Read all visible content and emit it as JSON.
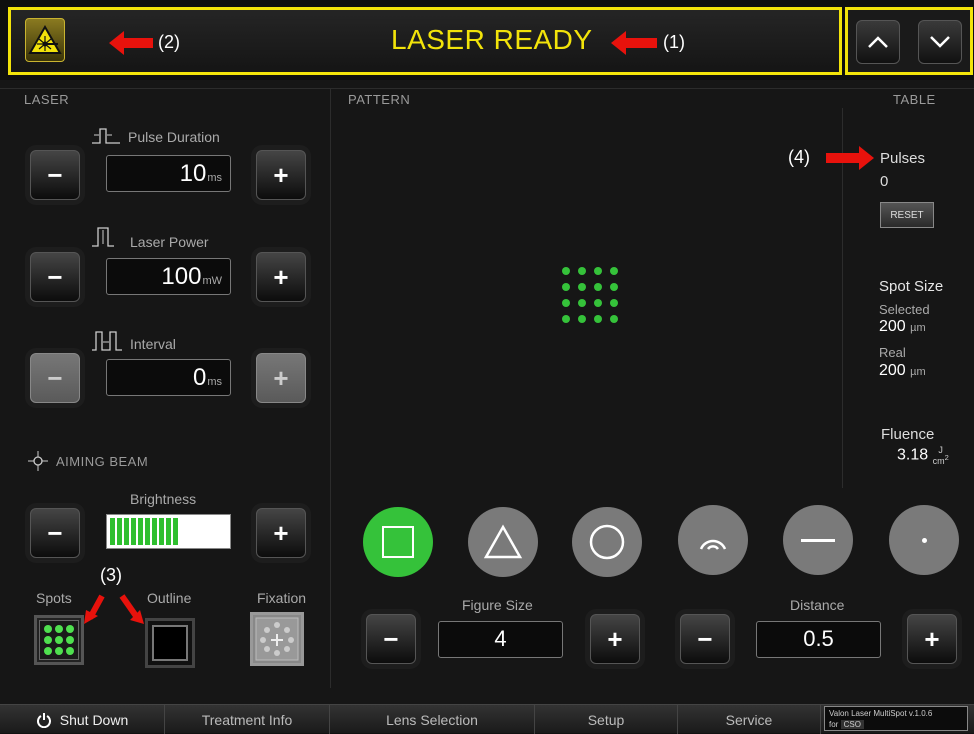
{
  "header": {
    "status": "LASER READY",
    "annotation_1": "(1)",
    "annotation_2": "(2)",
    "up_icon": "chevron-up-icon",
    "down_icon": "chevron-down-icon",
    "warning_icon": "laser-warning-icon",
    "status_color": "#f2e30a"
  },
  "laser": {
    "title": "LASER",
    "pulse_duration": {
      "label": "Pulse Duration",
      "value": "10",
      "unit": "ms"
    },
    "laser_power": {
      "label": "Laser Power",
      "value": "100",
      "unit": "mW"
    },
    "interval": {
      "label": "Interval",
      "value": "0",
      "unit": "ms"
    },
    "minus": "−",
    "plus": "+"
  },
  "aiming": {
    "title": "AIMING BEAM",
    "brightness_label": "Brightness",
    "brightness_level": 0.6,
    "spots_label": "Spots",
    "outline_label": "Outline",
    "fixation_label": "Fixation",
    "annotation_3": "(3)"
  },
  "pattern": {
    "title": "PATTERN",
    "grid_rows": 4,
    "grid_cols": 4,
    "figure_size_label": "Figure Size",
    "figure_size_value": "4",
    "distance_label": "Distance",
    "distance_value": "0.5",
    "shapes": [
      "square-icon",
      "triangle-icon",
      "circle-icon",
      "arc-icon",
      "line-icon",
      "dot-icon"
    ],
    "accent": "#35c23a"
  },
  "table": {
    "title": "TABLE",
    "pulses_label": "Pulses",
    "pulses_value": "0",
    "reset_label": "RESET",
    "spot_size_label": "Spot Size",
    "selected_label": "Selected",
    "selected_value": "200",
    "selected_unit": "µm",
    "real_label": "Real",
    "real_value": "200",
    "real_unit": "µm",
    "fluence_label": "Fluence",
    "fluence_value": "3.18",
    "fluence_unit_top": "J",
    "fluence_unit_bottom": "cm",
    "fluence_unit_exp": "2",
    "annotation_4": "(4)"
  },
  "bottom": {
    "shut_down": "Shut Down",
    "treatment_info": "Treatment Info",
    "lens_selection": "Lens Selection",
    "setup": "Setup",
    "service": "Service",
    "version_line1": "Valon Laser MultiSpot v.1.0.6",
    "version_line2": "for",
    "version_line3": "CSO"
  }
}
